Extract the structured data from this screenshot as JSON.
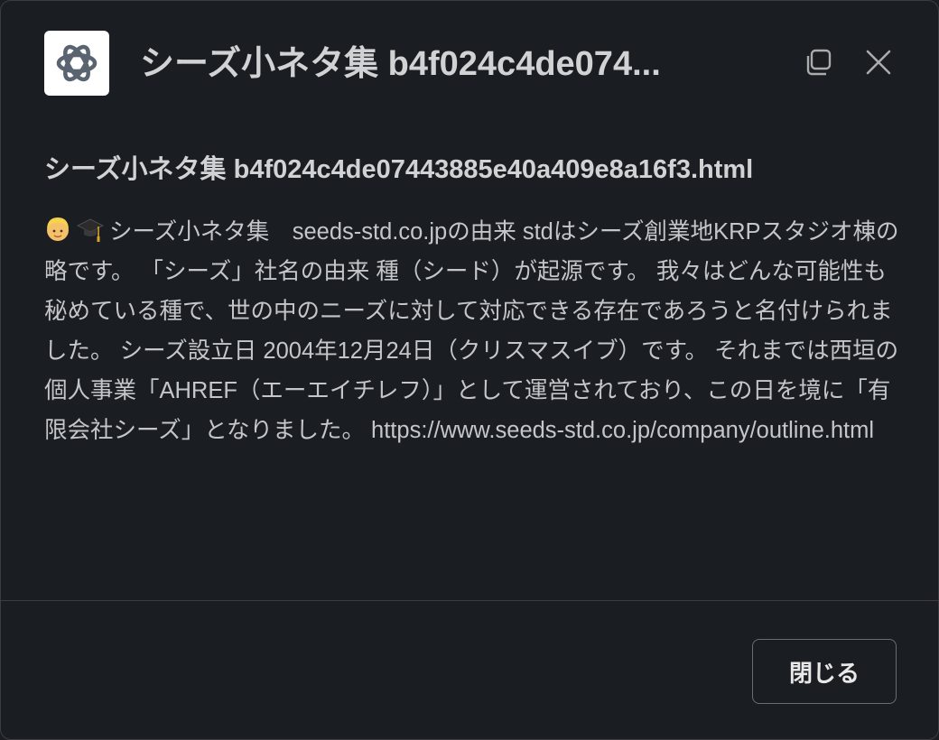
{
  "header": {
    "title": "シーズ小ネタ集 b4f024c4de074...",
    "app_icon": "openai-logo-icon",
    "copy_icon": "copy-icon",
    "close_icon": "close-icon"
  },
  "document": {
    "title": "シーズ小ネタ集 b4f024c4de07443885e40a409e8a16f3.html",
    "emojis": [
      "person-blond-icon",
      "graduation-cap-icon"
    ],
    "text": "シーズ小ネタ集　seeds-std.co.jpの由来  stdはシーズ創業地KRPスタジオ棟の略です。 「シーズ」社名の由来  種（シード）が起源です。 我々はどんな可能性も秘めている種で、世の中のニーズに対して対応できる存在であろうと名付けられました。 シーズ設立日 2004年12月24日（クリスマスイブ）です。 それまでは西垣の個人事業「AHREF（エーエイチレフ）」として運営されており、この日を境に「有限会社シーズ」となりました。 https://www.seeds-std.co.jp/company/outline.html"
  },
  "footer": {
    "close_label": "閉じる"
  },
  "colors": {
    "background": "#1a1d21",
    "text_primary": "#d1d2d3",
    "divider": "#3b3d42"
  }
}
